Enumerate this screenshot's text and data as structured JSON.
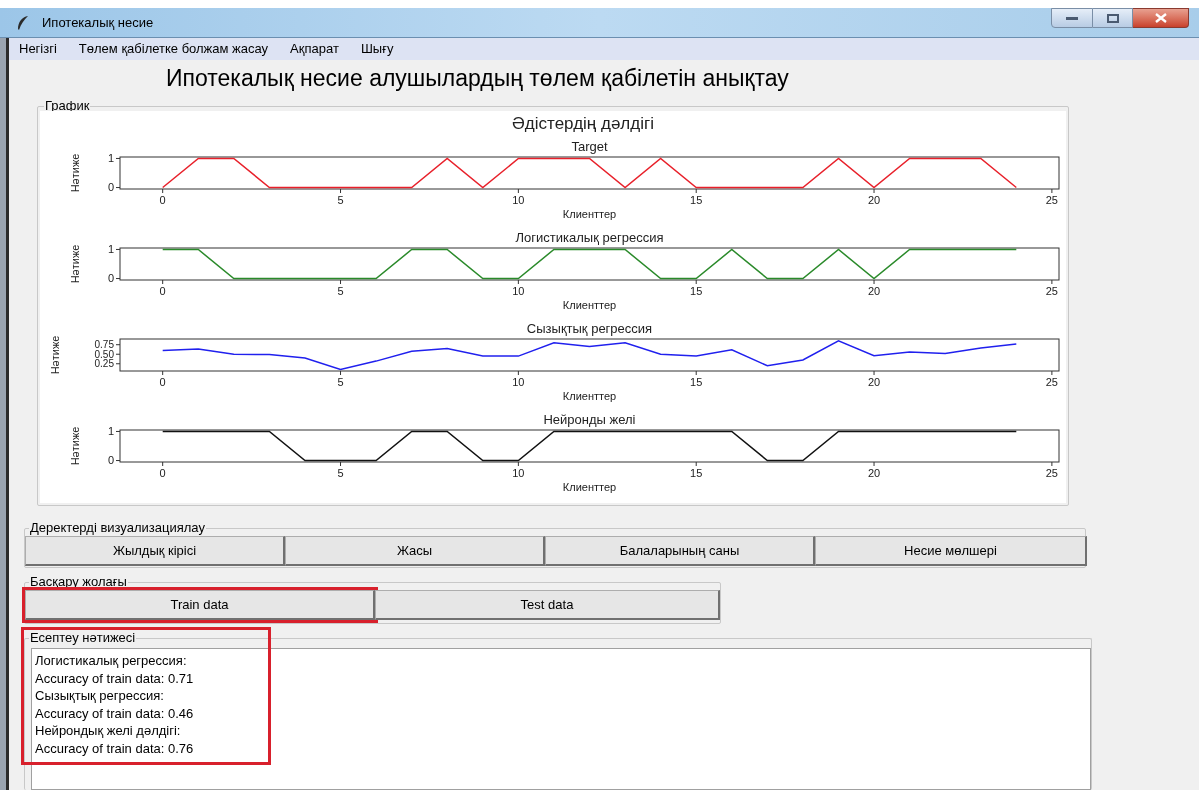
{
  "window": {
    "title": "Ипотекалық несие"
  },
  "menu": [
    "Негізгі",
    "Төлем қабілетке болжам жасау",
    "Ақпарат",
    "Шығу"
  ],
  "heading": "Ипотекалық несие алушылардың төлем қабілетін анықтау",
  "graph_group": {
    "label": "График",
    "figure_title": "Әдістердің дәлдігі",
    "charts": [
      {
        "chart_data": {
          "type": "line",
          "title": "Target",
          "xlabel": "Клиенттер",
          "ylabel": "Нәтиже",
          "x": [
            0,
            1,
            2,
            3,
            4,
            5,
            6,
            7,
            8,
            9,
            10,
            11,
            12,
            13,
            14,
            15,
            16,
            17,
            18,
            19,
            20,
            21,
            22,
            23,
            24
          ],
          "xlim": [
            -1.2,
            25.2
          ],
          "ylim": [
            -0.05,
            1.05
          ],
          "xticks": [
            0,
            5,
            10,
            15,
            20,
            25
          ],
          "yticks": [
            {
              "value": 0,
              "label": "0"
            },
            {
              "value": 1,
              "label": "1"
            }
          ],
          "series": [
            {
              "color": "#e8202a",
              "values": [
                0,
                1,
                1,
                0,
                0,
                0,
                0,
                0,
                1,
                0,
                1,
                1,
                1,
                0,
                1,
                0,
                0,
                0,
                0,
                1,
                0,
                1,
                1,
                1,
                0
              ]
            }
          ]
        }
      },
      {
        "chart_data": {
          "type": "line",
          "title": "Логистикалық регрессия",
          "xlabel": "Клиенттер",
          "ylabel": "Нәтиже",
          "x": [
            0,
            1,
            2,
            3,
            4,
            5,
            6,
            7,
            8,
            9,
            10,
            11,
            12,
            13,
            14,
            15,
            16,
            17,
            18,
            19,
            20,
            21,
            22,
            23,
            24
          ],
          "xlim": [
            -1.2,
            25.2
          ],
          "ylim": [
            -0.05,
            1.05
          ],
          "xticks": [
            0,
            5,
            10,
            15,
            20,
            25
          ],
          "yticks": [
            {
              "value": 0,
              "label": "0"
            },
            {
              "value": 1,
              "label": "1"
            }
          ],
          "series": [
            {
              "color": "#2a8a2a",
              "values": [
                1,
                1,
                0,
                0,
                0,
                0,
                0,
                1,
                1,
                0,
                0,
                1,
                1,
                1,
                0,
                0,
                1,
                0,
                0,
                1,
                0,
                1,
                1,
                1,
                1
              ]
            }
          ]
        }
      },
      {
        "chart_data": {
          "type": "line",
          "title": "Сызықтық регрессия",
          "xlabel": "Клиенттер",
          "ylabel": "Нәтиже",
          "x": [
            0,
            1,
            2,
            3,
            4,
            5,
            6,
            7,
            8,
            9,
            10,
            11,
            12,
            13,
            14,
            15,
            16,
            17,
            18,
            19,
            20,
            21,
            22,
            23,
            24
          ],
          "xlim": [
            -1.2,
            25.2
          ],
          "ylim": [
            0.06,
            0.9
          ],
          "xticks": [
            0,
            5,
            10,
            15,
            20,
            25
          ],
          "yticks": [
            {
              "value": 0.25,
              "label": "0.25"
            },
            {
              "value": 0.5,
              "label": "0.50"
            },
            {
              "value": 0.75,
              "label": "0.75"
            }
          ],
          "series": [
            {
              "color": "#2020ee",
              "values": [
                0.6,
                0.64,
                0.5,
                0.49,
                0.4,
                0.1,
                0.32,
                0.58,
                0.65,
                0.45,
                0.45,
                0.8,
                0.7,
                0.8,
                0.5,
                0.45,
                0.62,
                0.2,
                0.35,
                0.85,
                0.46,
                0.56,
                0.52,
                0.66,
                0.77
              ]
            }
          ]
        }
      },
      {
        "chart_data": {
          "type": "line",
          "title": "Нейронды желі",
          "xlabel": "Клиенттер",
          "ylabel": "Нәтиже",
          "x": [
            0,
            1,
            2,
            3,
            4,
            5,
            6,
            7,
            8,
            9,
            10,
            11,
            12,
            13,
            14,
            15,
            16,
            17,
            18,
            19,
            20,
            21,
            22,
            23,
            24
          ],
          "xlim": [
            -1.2,
            25.2
          ],
          "ylim": [
            -0.05,
            1.05
          ],
          "xticks": [
            0,
            5,
            10,
            15,
            20,
            25
          ],
          "yticks": [
            {
              "value": 0,
              "label": "0"
            },
            {
              "value": 1,
              "label": "1"
            }
          ],
          "series": [
            {
              "color": "#111111",
              "values": [
                1,
                1,
                1,
                1,
                0,
                0,
                0,
                1,
                1,
                0,
                0,
                1,
                1,
                1,
                1,
                1,
                1,
                0,
                0,
                1,
                1,
                1,
                1,
                1,
                1
              ]
            }
          ]
        }
      }
    ]
  },
  "visualization_group": {
    "label": "Деректерді визуализациялау",
    "buttons": [
      "Жылдық кірісі",
      "Жасы",
      "Балаларының саны",
      "Несие мөлшері"
    ]
  },
  "control_group": {
    "label": "Басқару жолағы",
    "buttons": [
      {
        "label": "Train data",
        "highlighted": true
      },
      {
        "label": "Test data",
        "highlighted": false
      }
    ]
  },
  "results_group": {
    "label": "Есептеу нәтижесі",
    "highlighted": true,
    "lines": [
      "Логистикалық регрессия:",
      "Accuracy of train data: 0.71",
      "Сызықтық регрессия:",
      "Accuracy of train data: 0.46",
      "Нейрондық желі дәлдігі:",
      "Accuracy of train data: 0.76"
    ]
  }
}
